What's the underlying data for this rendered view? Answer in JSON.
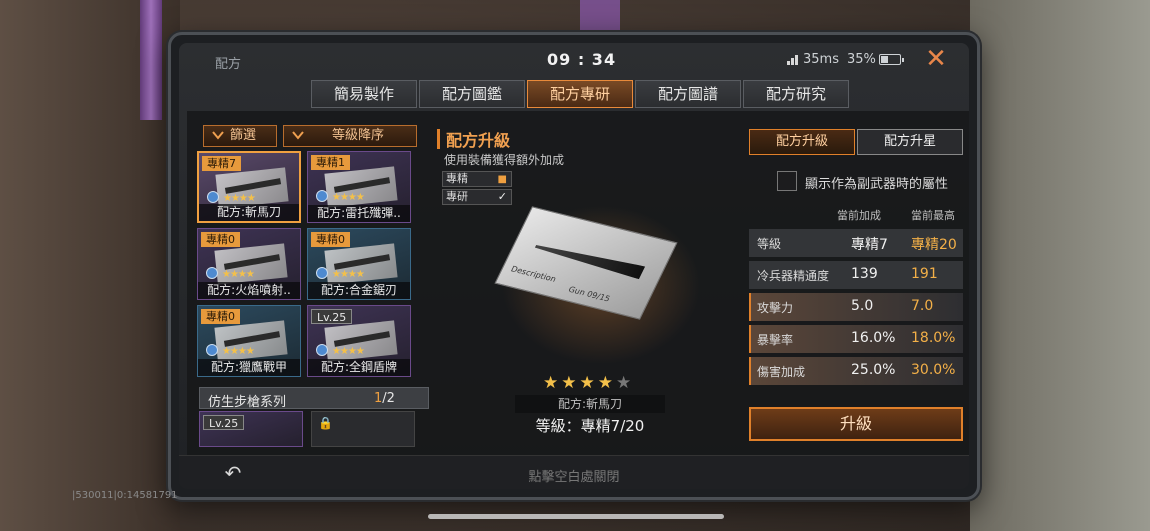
{
  "status": {
    "title": "配方",
    "time": "09 : 34",
    "ping": "35ms",
    "battery": "35%"
  },
  "tabs": [
    "簡易製作",
    "配方圖鑑",
    "配方專研",
    "配方圖譜",
    "配方研究"
  ],
  "active_tab": 2,
  "filters": {
    "filter": "篩選",
    "sort": "等級降序"
  },
  "cards": [
    {
      "badge": "專精7",
      "name": "配方:斬馬刀"
    },
    {
      "badge": "專精1",
      "name": "配方:雷托殲彈.."
    },
    {
      "badge": "專精0",
      "name": "配方:火焰噴射.."
    },
    {
      "badge": "專精0",
      "name": "配方:合金鋸刃"
    },
    {
      "badge": "專精0",
      "name": "配方:獵鷹戰甲"
    },
    {
      "badge": "Lv.25",
      "name": "配方:全鋼盾牌"
    }
  ],
  "series": {
    "label": "仿生步槍系列",
    "current": "1",
    "total": "/2",
    "item_badge": "Lv.25"
  },
  "center": {
    "title": "配方升級",
    "subtitle": "使用裝備獲得額外加成",
    "opt1": "專精",
    "opt2": "專研",
    "blueprint_text1": "Description",
    "blueprint_text2": "Gun 09/15",
    "stars_on": "★★★★",
    "stars_off": "★",
    "name": "配方:斬馬刀",
    "level": "等級：專精7/20"
  },
  "right": {
    "tab1": "配方升級",
    "tab2": "配方升星",
    "checkbox_label": "顯示作為副武器時的屬性",
    "col1": "當前加成",
    "col2": "當前最高",
    "rows": [
      {
        "k": "等級",
        "v1": "專精7",
        "v2": "專精20"
      },
      {
        "k": "冷兵器精通度",
        "v1": "139",
        "v2": "191"
      },
      {
        "k": "攻擊力",
        "v1": "5.0",
        "v2": "7.0"
      },
      {
        "k": "暴擊率",
        "v1": "16.0%",
        "v2": "18.0%"
      },
      {
        "k": "傷害加成",
        "v1": "25.0%",
        "v2": "30.0%"
      }
    ],
    "upgrade": "升級"
  },
  "bottom": {
    "back_icon": "↶",
    "tap_close": "點擊空白處關閉"
  },
  "id_line": "|530011|0:14581791"
}
